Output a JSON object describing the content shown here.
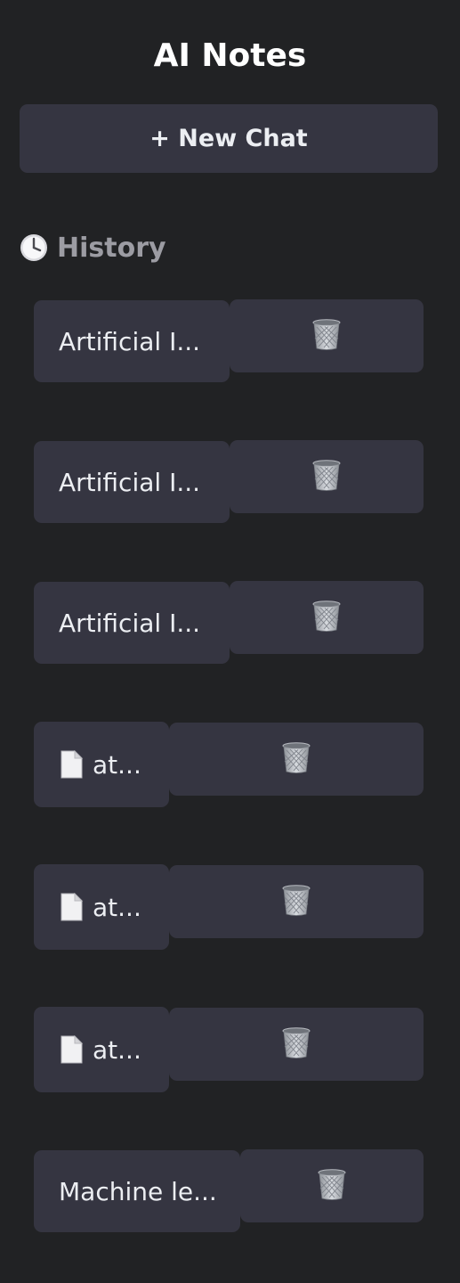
{
  "app": {
    "title": "AI Notes"
  },
  "new_chat": {
    "label": "+ New Chat"
  },
  "history": {
    "heading": "History",
    "heading_icon": "clock-icon",
    "items": [
      {
        "label": "Artificial I...",
        "icon": "",
        "delete_icon": "trash-icon"
      },
      {
        "label": "Artificial I...",
        "icon": "",
        "delete_icon": "trash-icon"
      },
      {
        "label": "Artificial I...",
        "icon": "",
        "delete_icon": "trash-icon"
      },
      {
        "label": "at...",
        "icon": "document-icon",
        "delete_icon": "trash-icon"
      },
      {
        "label": "at...",
        "icon": "document-icon",
        "delete_icon": "trash-icon"
      },
      {
        "label": "at...",
        "icon": "document-icon",
        "delete_icon": "trash-icon"
      },
      {
        "label": "Machine le...",
        "icon": "",
        "delete_icon": "trash-icon"
      }
    ]
  },
  "colors": {
    "background": "#212224",
    "panel": "#353541",
    "text": "#eceef2",
    "muted": "#9c9ca3"
  }
}
